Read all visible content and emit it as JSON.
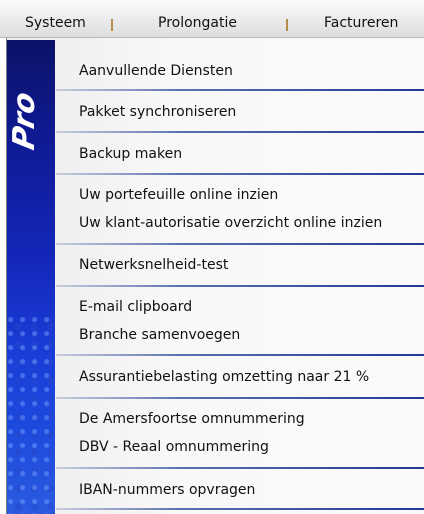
{
  "menubar": {
    "items": [
      "Systeem",
      "Prolongatie",
      "Factureren"
    ]
  },
  "sidebar": {
    "logo": "Pro"
  },
  "menu": {
    "items": [
      "Aanvullende Diensten",
      "Pakket synchroniseren",
      "Backup maken",
      "Uw portefeuille online inzien",
      "Uw klant-autorisatie overzicht online inzien",
      "Netwerksnelheid-test",
      "E-mail clipboard",
      "Branche samenvoegen",
      "Assurantiebelasting omzetting naar 21 %",
      "De Amersfoortse omnummering",
      "DBV - Reaal omnummering",
      "IBAN-nummers opvragen"
    ]
  }
}
